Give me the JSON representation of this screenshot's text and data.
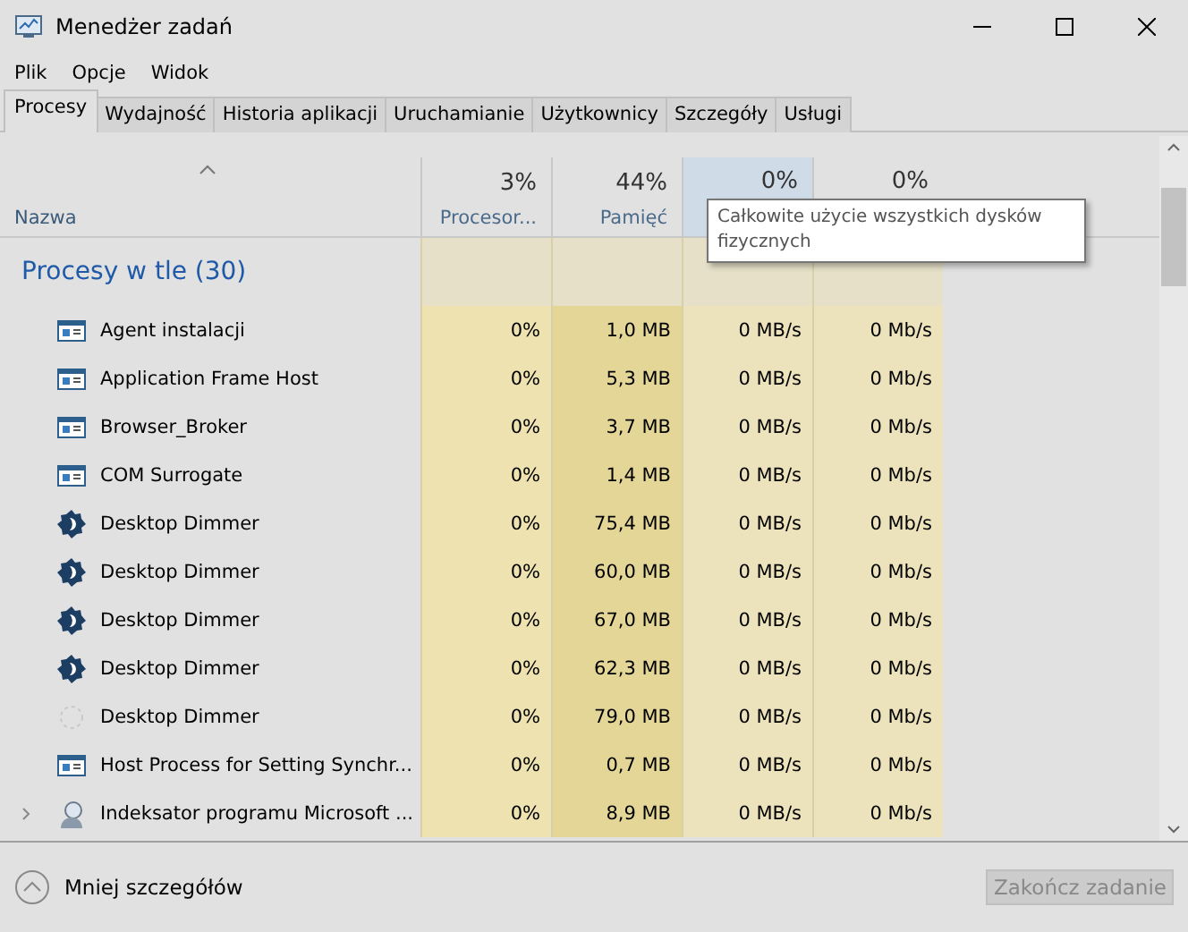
{
  "window": {
    "title": "Menedżer zadań"
  },
  "menu": [
    "Plik",
    "Opcje",
    "Widok"
  ],
  "tabs": [
    {
      "label": "Procesy",
      "selected": true
    },
    {
      "label": "Wydajność",
      "selected": false
    },
    {
      "label": "Historia aplikacji",
      "selected": false
    },
    {
      "label": "Uruchamianie",
      "selected": false
    },
    {
      "label": "Użytkownicy",
      "selected": false
    },
    {
      "label": "Szczegóły",
      "selected": false
    },
    {
      "label": "Usługi",
      "selected": false
    }
  ],
  "columns": [
    {
      "label": "Nazwa",
      "highlighted": false
    },
    {
      "percent": "3%",
      "label": "Procesor...",
      "highlighted": false
    },
    {
      "percent": "44%",
      "label": "Pamięć",
      "highlighted": false
    },
    {
      "percent": "0%",
      "highlighted": true
    },
    {
      "percent": "0%",
      "highlighted": false
    }
  ],
  "tooltip": "Całkowite użycie wszystkich dysków fizycznych",
  "group": "Procesy w tle (30)",
  "rows": [
    {
      "kind": "window",
      "name": "Agent instalacji",
      "expandable": false,
      "cpu": "0%",
      "memory": "1,0 MB",
      "disk": "0 MB/s",
      "network": "0 Mb/s"
    },
    {
      "kind": "window",
      "name": "Application Frame Host",
      "expandable": false,
      "cpu": "0%",
      "memory": "5,3 MB",
      "disk": "0 MB/s",
      "network": "0 Mb/s"
    },
    {
      "kind": "window",
      "name": "Browser_Broker",
      "expandable": false,
      "cpu": "0%",
      "memory": "3,7 MB",
      "disk": "0 MB/s",
      "network": "0 Mb/s"
    },
    {
      "kind": "window",
      "name": "COM Surrogate",
      "expandable": false,
      "cpu": "0%",
      "memory": "1,4 MB",
      "disk": "0 MB/s",
      "network": "0 Mb/s"
    },
    {
      "kind": "dimmer",
      "name": "Desktop Dimmer",
      "expandable": false,
      "cpu": "0%",
      "memory": "75,4 MB",
      "disk": "0 MB/s",
      "network": "0 Mb/s"
    },
    {
      "kind": "dimmer",
      "name": "Desktop Dimmer",
      "expandable": false,
      "cpu": "0%",
      "memory": "60,0 MB",
      "disk": "0 MB/s",
      "network": "0 Mb/s"
    },
    {
      "kind": "dimmer",
      "name": "Desktop Dimmer",
      "expandable": false,
      "cpu": "0%",
      "memory": "67,0 MB",
      "disk": "0 MB/s",
      "network": "0 Mb/s"
    },
    {
      "kind": "dimmer",
      "name": "Desktop Dimmer",
      "expandable": false,
      "cpu": "0%",
      "memory": "62,3 MB",
      "disk": "0 MB/s",
      "network": "0 Mb/s"
    },
    {
      "kind": "faded",
      "name": "Desktop Dimmer",
      "expandable": false,
      "cpu": "0%",
      "memory": "79,0 MB",
      "disk": "0 MB/s",
      "network": "0 Mb/s"
    },
    {
      "kind": "window",
      "name": "Host Process for Setting Synchr...",
      "expandable": false,
      "cpu": "0%",
      "memory": "0,7 MB",
      "disk": "0 MB/s",
      "network": "0 Mb/s"
    },
    {
      "kind": "search",
      "name": "Indeksator programu Microsoft ...",
      "expandable": true,
      "cpu": "0%",
      "memory": "8,9 MB",
      "disk": "0 MB/s",
      "network": "0 Mb/s"
    }
  ],
  "footer": {
    "toggle": "Mniej szczegółów",
    "end_task": {
      "label": "Zakończ zadanie",
      "disabled": true
    }
  }
}
